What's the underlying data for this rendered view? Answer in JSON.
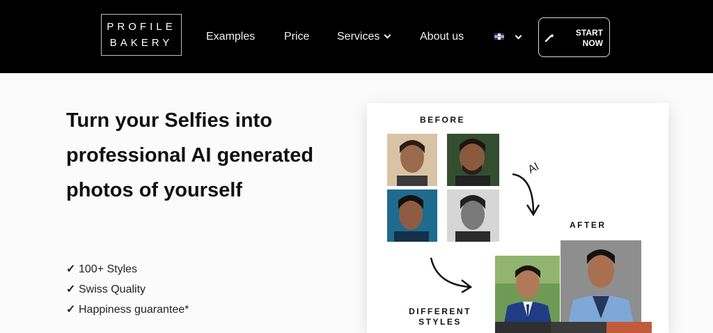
{
  "header": {
    "logo": {
      "line1": "PROFILE",
      "line2": "BAKERY"
    },
    "nav": [
      {
        "label": "Examples"
      },
      {
        "label": "Price"
      },
      {
        "label": "Services"
      },
      {
        "label": "About us"
      }
    ],
    "language_icon": "uk-flag-icon",
    "cta": {
      "line1": "START",
      "line2": "NOW",
      "icon": "magic-wand-icon"
    }
  },
  "hero": {
    "headline": "Turn your Selfies into professional AI generated photos of yourself",
    "features": [
      {
        "check": "✓",
        "text": "100+ Styles"
      },
      {
        "check": "✓",
        "text": "Swiss Quality"
      },
      {
        "check": "✓",
        "text": "Happiness guarantee*"
      }
    ]
  },
  "showcase": {
    "before_label": "BEFORE",
    "after_label": "AFTER",
    "ai_label": "AI",
    "styles_label_line1": "DIFFERENT",
    "styles_label_line2": "STYLES"
  },
  "colors": {
    "nav_bg": "#000000",
    "page_bg": "#fbfbfb",
    "text": "#111111"
  }
}
